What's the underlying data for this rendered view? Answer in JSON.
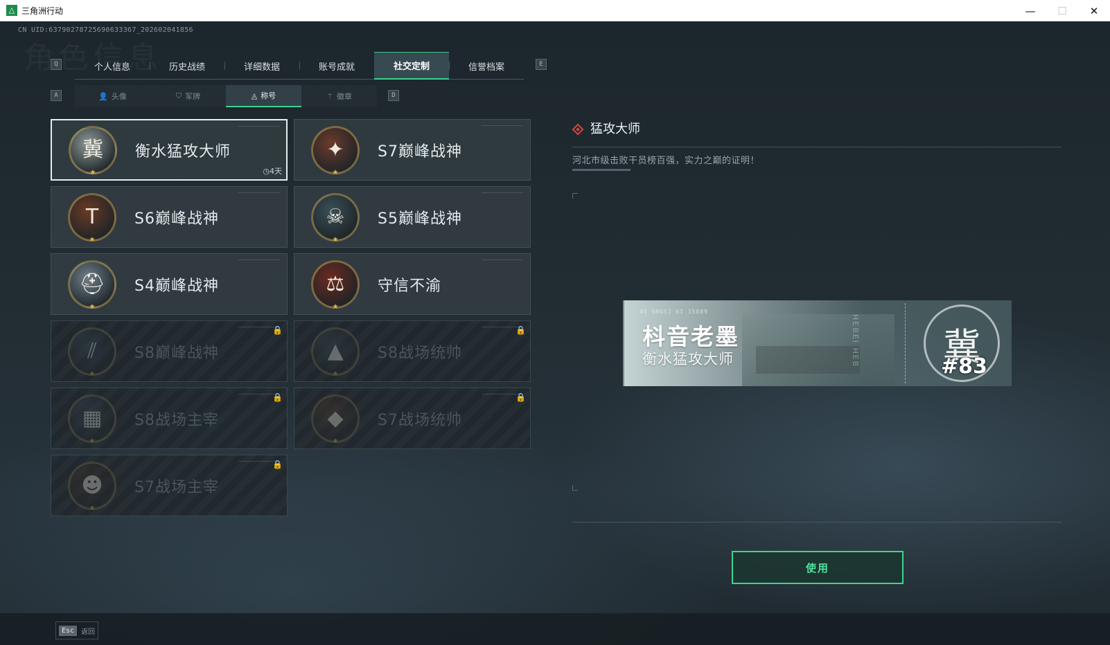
{
  "window": {
    "title": "三角洲行动",
    "minimize_icon": "—",
    "maximize_icon": "☐",
    "close_icon": "✕"
  },
  "uid": "CN UID:63790278725690633367_202602041856",
  "watermark": "角色信息",
  "nav": {
    "prev_key": "Q",
    "next_key": "E",
    "tabs": [
      "个人信息",
      "历史战绩",
      "详细数据",
      "账号成就",
      "社交定制",
      "信誉档案"
    ],
    "active_tab": "社交定制"
  },
  "subnav": {
    "prev_key": "A",
    "next_key": "D",
    "tabs": [
      {
        "label": "头像",
        "icon": "person-icon"
      },
      {
        "label": "军牌",
        "icon": "dogtag-icon"
      },
      {
        "label": "称号",
        "icon": "triangle-badge-icon"
      },
      {
        "label": "徽章",
        "icon": "wing-icon"
      }
    ],
    "active_tab": "称号"
  },
  "titles": [
    {
      "name": "衡水猛攻大师",
      "emblem": "冀",
      "emblem_icon": "hebei-emblem-icon",
      "locked": false,
      "selected": true,
      "timer": "4天"
    },
    {
      "name": "S7巅峰战神",
      "emblem": "✦",
      "emblem_icon": "rifle-emblem-icon",
      "locked": false
    },
    {
      "name": "S6巅峰战神",
      "emblem": "T",
      "emblem_icon": "t-shield-emblem-icon",
      "locked": false
    },
    {
      "name": "S5巅峰战神",
      "emblem": "☠",
      "emblem_icon": "skull-emblem-icon",
      "locked": false
    },
    {
      "name": "S4巅峰战神",
      "emblem": "⛑",
      "emblem_icon": "helmet-emblem-icon",
      "locked": false
    },
    {
      "name": "守信不渝",
      "emblem": "⚖",
      "emblem_icon": "scales-emblem-icon",
      "locked": false
    },
    {
      "name": "S8巅峰战神",
      "emblem": "⫽",
      "emblem_icon": "stripes-emblem-icon",
      "locked": true
    },
    {
      "name": "S8战场统帅",
      "emblem": "▲",
      "emblem_icon": "tank-emblem-icon",
      "locked": true
    },
    {
      "name": "S8战场主宰",
      "emblem": "▦",
      "emblem_icon": "rocket-pod-emblem-icon",
      "locked": true
    },
    {
      "name": "S7战场统帅",
      "emblem": "◆",
      "emblem_icon": "vehicle-emblem-icon",
      "locked": true
    },
    {
      "name": "S7战场主宰",
      "emblem": "☻",
      "emblem_icon": "face-emblem-icon",
      "locked": true
    }
  ],
  "detail": {
    "title": "猛攻大师",
    "description": "河北市级击败干员榜百强，实力之巅的证明！"
  },
  "plate": {
    "code": "45  SHSSJ  61  15889",
    "player_name": "枓音老墨",
    "title": "衡水猛攻大师",
    "vertical_text": "HEBEI  HEB",
    "emblem": "冀",
    "rank": "#83"
  },
  "use_button": "使用",
  "footer": {
    "esc_key": "Esc",
    "esc_label": "返回"
  },
  "icons": {
    "lock": "🔒",
    "clock": "◷",
    "star": "★"
  },
  "colors": {
    "accent": "#39d28f",
    "marker": "#d9443f"
  }
}
